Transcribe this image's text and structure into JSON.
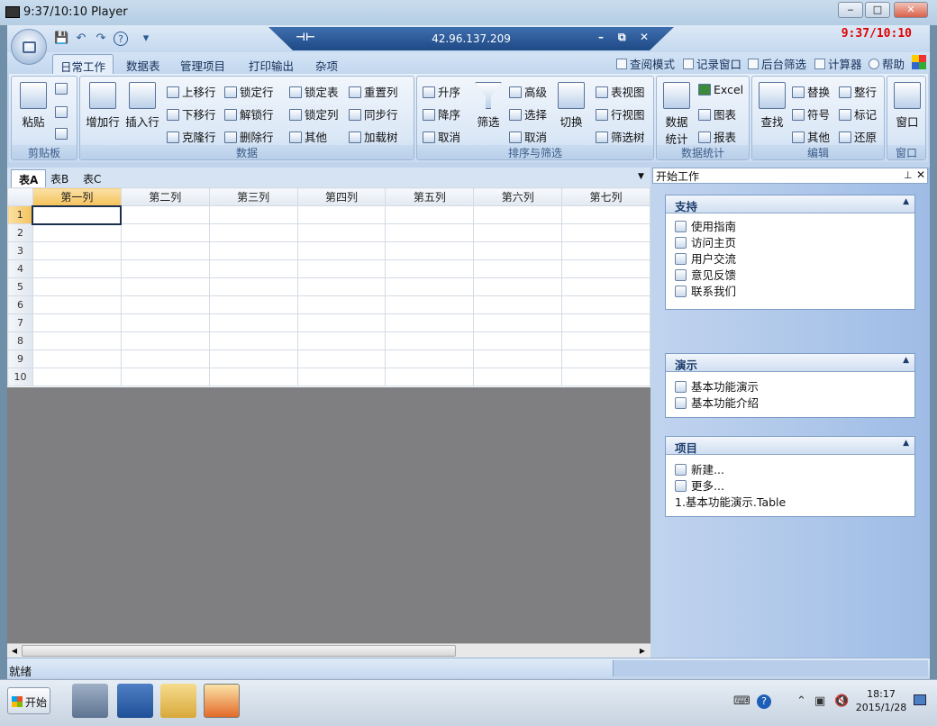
{
  "outer_window": {
    "title": "9:37/10:10 Player",
    "min": "‒",
    "max": "□",
    "close": "✕"
  },
  "remote_bar": {
    "ip": "42.96.137.209",
    "pin": "⊣⊢",
    "min": "–",
    "restore": "⧉",
    "close": "✕"
  },
  "time_overlay": "9:37/10:10",
  "quick_access": {
    "save": "💾",
    "undo": "↶",
    "redo": "↷",
    "help": "?",
    "more": "▾"
  },
  "tabs": [
    "日常工作",
    "数据表",
    "管理项目",
    "打印输出",
    "杂项"
  ],
  "right_links": {
    "read_mode": "查阅模式",
    "record_window": "记录窗口",
    "bg_filter": "后台筛选",
    "calculator": "计算器",
    "help": "帮助"
  },
  "ribbon": {
    "clipboard": {
      "label": "剪贴板",
      "paste": "粘贴"
    },
    "data": {
      "label": "数据",
      "add_row": "增加行",
      "insert_row": "插入行",
      "move_up": "上移行",
      "move_down": "下移行",
      "clone_row": "克隆行",
      "lock_row": "锁定行",
      "unlock_row": "解锁行",
      "delete_row": "删除行",
      "lock_table": "锁定表",
      "lock_col": "锁定列",
      "other": "其他",
      "reset_col": "重置列",
      "sync_row": "同步行",
      "load_tree": "加载树"
    },
    "sort": {
      "label": "排序与筛选",
      "asc": "升序",
      "desc": "降序",
      "cancel": "取消",
      "filter": "筛选",
      "advanced": "高级",
      "select": "选择",
      "cancel2": "取消",
      "switch": "切换",
      "table_view": "表视图",
      "row_view": "行视图",
      "filter_tree": "筛选树"
    },
    "stats": {
      "label": "数据统计",
      "data_stats": "数据统计",
      "excel": "Excel",
      "chart": "图表",
      "report": "报表"
    },
    "edit": {
      "label": "编辑",
      "find": "查找",
      "replace": "替换",
      "symbol": "符号",
      "other": "其他",
      "tidy": "整行",
      "mark": "标记",
      "restore": "还原"
    },
    "window": {
      "label": "窗口",
      "window": "窗口"
    }
  },
  "sheet_tabs": [
    "表A",
    "表B",
    "表C"
  ],
  "columns": [
    "第一列",
    "第二列",
    "第三列",
    "第四列",
    "第五列",
    "第六列",
    "第七列"
  ],
  "rows": [
    "1",
    "2",
    "3",
    "4",
    "5",
    "6",
    "7",
    "8",
    "9",
    "10"
  ],
  "task_pane": {
    "title": "开始工作",
    "support": {
      "title": "支持",
      "items": [
        "使用指南",
        "访问主页",
        "用户交流",
        "意见反馈",
        "联系我们"
      ]
    },
    "demo": {
      "title": "演示",
      "items": [
        "基本功能演示",
        "基本功能介绍"
      ]
    },
    "project": {
      "title": "项目",
      "items": [
        "新建...",
        "更多...",
        "1.基本功能演示.Table"
      ]
    }
  },
  "status": {
    "ready": "就绪"
  },
  "taskbar": {
    "start": "开始",
    "time": "18:17",
    "date": "2015/1/28"
  }
}
